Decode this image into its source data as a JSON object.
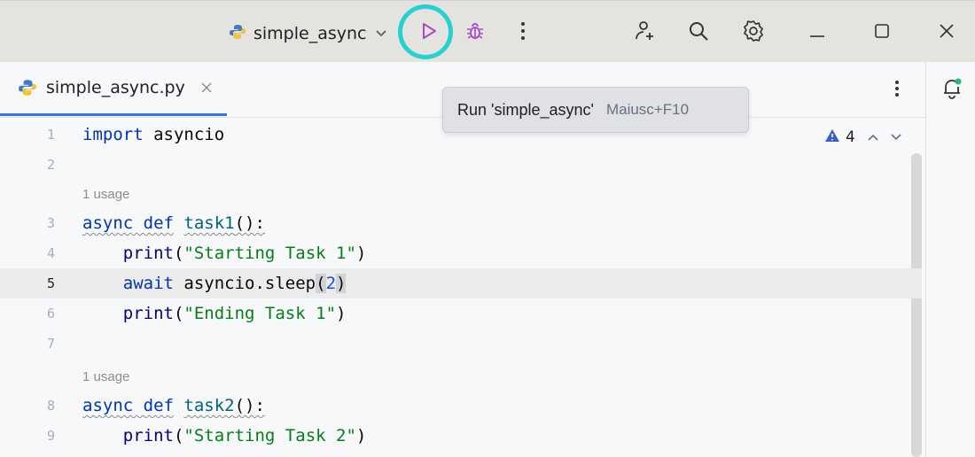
{
  "titlebar": {
    "run_config_name": "simple_async",
    "icons": [
      "python-icon",
      "run-icon",
      "debug-icon",
      "more-vertical-icon",
      "add-user-icon",
      "search-icon",
      "settings-icon",
      "minimize-icon",
      "maximize-icon",
      "close-icon"
    ]
  },
  "tooltip": {
    "text": "Run 'simple_async'",
    "shortcut": "Maiusc+F10"
  },
  "tabs": [
    {
      "label": "simple_async.py",
      "icon": "python-icon",
      "active": true
    }
  ],
  "inspections": {
    "warning_count": "4"
  },
  "editor": {
    "lines": [
      {
        "num": "1"
      },
      {
        "num": "2"
      },
      {
        "num": "3"
      },
      {
        "num": "4"
      },
      {
        "num": "5"
      },
      {
        "num": "6"
      },
      {
        "num": "7"
      },
      {
        "num": "8"
      },
      {
        "num": "9"
      }
    ],
    "usage_hint_1": "1 usage",
    "usage_hint_2": "1 usage",
    "code": {
      "l1_kw": "import",
      "l1_mod": " asyncio",
      "l3_kw": "async def",
      "l3_fn": "task1",
      "l3_tail": "():",
      "l4_fn": "print",
      "l4_open": "(",
      "l4_str": "\"Starting Task 1\"",
      "l4_close": ")",
      "l5_kw": "await",
      "l5_call": " asyncio.sleep",
      "l5_open": "(",
      "l5_num": "2",
      "l5_close": ")",
      "l6_fn": "print",
      "l6_open": "(",
      "l6_str": "\"Ending Task 1\"",
      "l6_close": ")",
      "l8_kw": "async def",
      "l8_fn": "task2",
      "l8_tail": "():",
      "l9_fn": "print",
      "l9_open": "(",
      "l9_str": "\"Starting Task 2\"",
      "l9_close": ")"
    }
  },
  "colors": {
    "accent": "#3574f0",
    "highlight_ring": "#25d1d1",
    "run_icon": "#a64ac9"
  }
}
